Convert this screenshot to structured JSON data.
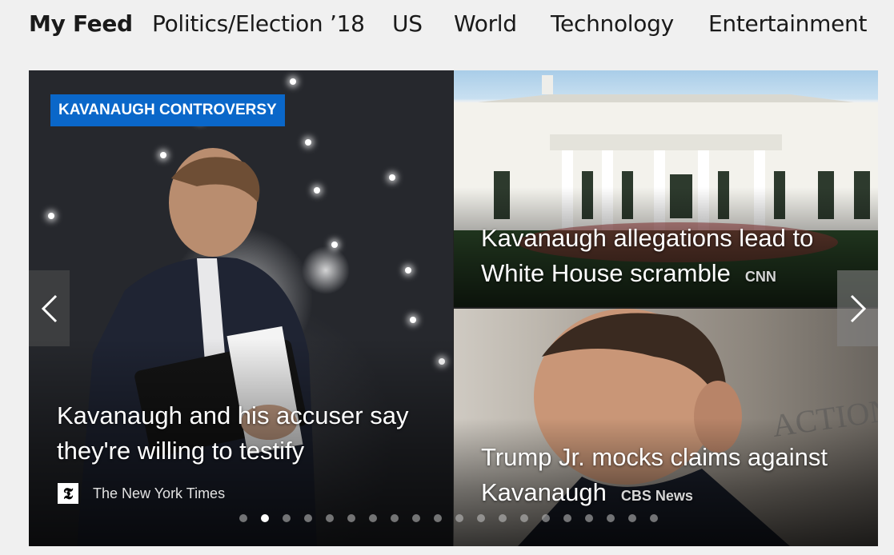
{
  "nav": {
    "items": [
      {
        "label": "My Feed",
        "active": true
      },
      {
        "label": "Politics/Election ’18",
        "active": false
      },
      {
        "label": "US",
        "active": false
      },
      {
        "label": "World",
        "active": false
      },
      {
        "label": "Technology",
        "active": false
      },
      {
        "label": "Entertainment",
        "active": false
      }
    ]
  },
  "carousel": {
    "tiles": [
      {
        "badge": "KAVANAUGH CONTROVERSY",
        "headline_line1": "Kavanaugh and his accuser say",
        "headline_line2": "they're willing to testify",
        "source": "The New York Times",
        "source_icon": "nyt-logo-icon",
        "logo_glyph": "𝕿"
      },
      {
        "headline_line1": "Kavanaugh allegations lead to",
        "headline_line2": "White House scramble",
        "source": "CNN"
      },
      {
        "headline_line1": "Trump Jr. mocks claims against",
        "headline_line2": "Kavanaugh",
        "source": "CBS News"
      }
    ],
    "prev_icon": "chevron-left-icon",
    "next_icon": "chevron-right-icon",
    "dots_total": 20,
    "dots_active_index": 1
  },
  "colors": {
    "badge_bg": "#0a67c9",
    "page_bg": "#f0f0f0"
  }
}
